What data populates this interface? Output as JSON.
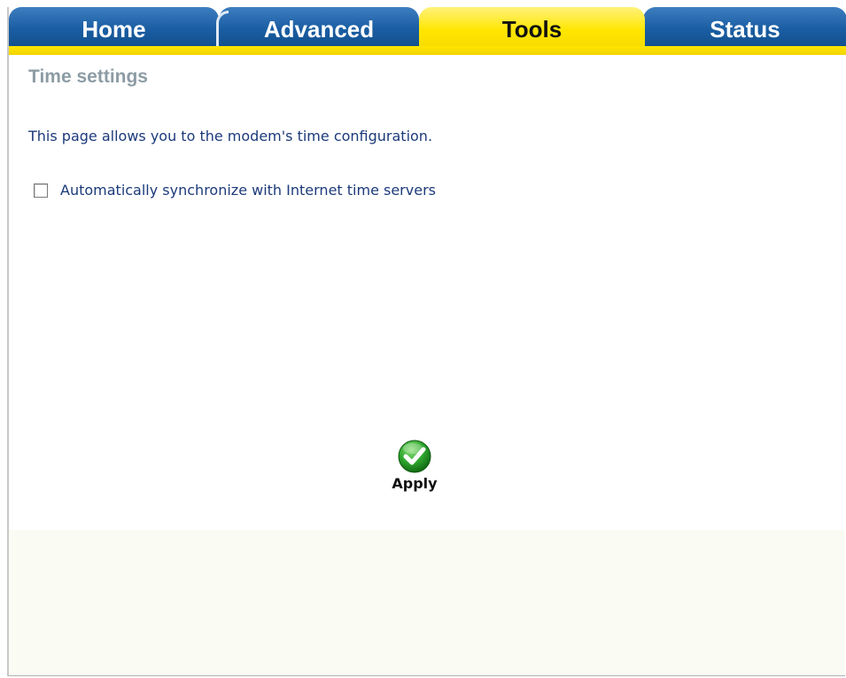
{
  "tabs": [
    {
      "label": "Home",
      "active": false
    },
    {
      "label": "Advanced",
      "active": false
    },
    {
      "label": "Tools",
      "active": true
    },
    {
      "label": "Status",
      "active": false
    }
  ],
  "page": {
    "title": "Time settings",
    "description": "This page allows you to the modem's time configuration."
  },
  "sync": {
    "label": "Automatically synchronize with Internet time servers",
    "checked": false
  },
  "apply": {
    "label": "Apply",
    "icon": "check-circle-icon"
  },
  "colors": {
    "tab_blue": "#1b5ea3",
    "tab_active_yellow": "#ffe600",
    "title_gray": "#8c9ca4",
    "text_navy": "#1c3a7a",
    "apply_green": "#2fa82f"
  }
}
